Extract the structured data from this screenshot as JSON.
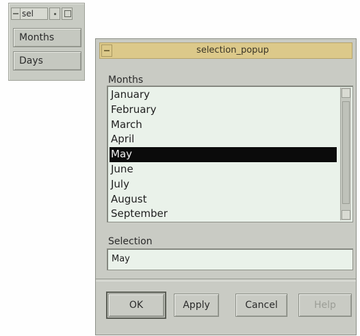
{
  "small_window": {
    "title": "sel",
    "buttons": [
      "Months",
      "Days"
    ]
  },
  "popup": {
    "title": "selection_popup",
    "list_label": "Months",
    "items": [
      "January",
      "February",
      "March",
      "April",
      "May",
      "June",
      "July",
      "August",
      "September"
    ],
    "selected_item": "May",
    "selection_label": "Selection",
    "selection_value": "May",
    "buttons": {
      "ok": "OK",
      "apply": "Apply",
      "cancel": "Cancel",
      "help": "Help"
    }
  },
  "colors": {
    "popup_titlebar": "#dcc98a",
    "list_background": "#eaf2ea",
    "selected_background": "#0b0b0b"
  }
}
